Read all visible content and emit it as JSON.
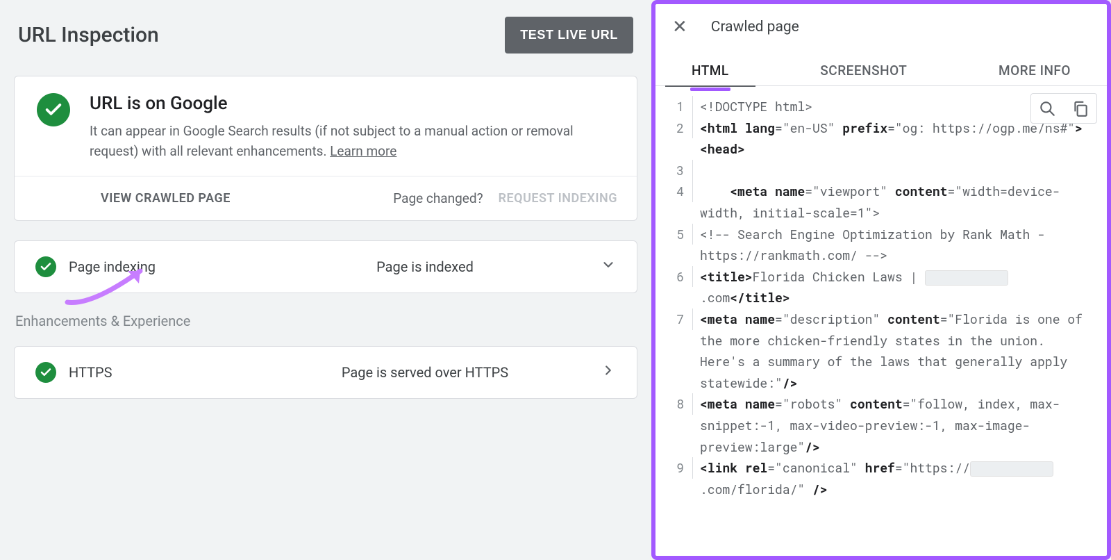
{
  "header": {
    "title": "URL Inspection",
    "test_live_label": "TEST LIVE URL"
  },
  "status": {
    "heading": "URL is on Google",
    "description_a": "It can appear in Google Search results (if not subject to a manual action or removal request) with all relevant enhancements. ",
    "learn_more": "Learn more"
  },
  "actions": {
    "view_crawled": "VIEW CRAWLED PAGE",
    "page_changed": "Page changed?",
    "request_indexing": "REQUEST INDEXING"
  },
  "rows": {
    "page_indexing_label": "Page indexing",
    "page_indexing_value": "Page is indexed",
    "https_label": "HTTPS",
    "https_value": "Page is served over HTTPS"
  },
  "section_heading": "Enhancements & Experience",
  "right": {
    "title": "Crawled page",
    "tabs": {
      "html": "HTML",
      "screenshot": "SCREENSHOT",
      "more": "MORE INFO"
    }
  },
  "code": {
    "l1": "<!DOCTYPE html>",
    "l2a": "<html lang",
    "l2b": "=\"en-US\" ",
    "l2c": "prefix",
    "l2d": "=\"og: https://ogp.me/ns#\"",
    "l2e": "><head>",
    "l4": "    <meta name",
    "l4b": "=\"viewport\" ",
    "l4c": "content",
    "l4d": "=\"width=device-width, initial-scale=1\">",
    "l5": "<!-- Search Engine Optimization by Rank Math - https://rankmath.com/ -->",
    "l6a": "<title>",
    "l6b": "Florida Chicken Laws | ",
    "l6c": ".com",
    "l6d": "</title>",
    "l7a": "<meta name",
    "l7b": "=\"description\" ",
    "l7c": "content",
    "l7d": "=\"Florida is one of the more chicken-friendly states in the union. Here's a summary of the laws that generally apply statewide:\"",
    "l7e": "/>",
    "l8a": "<meta name",
    "l8b": "=\"robots\" ",
    "l8c": "content",
    "l8d": "=\"follow, index, max-snippet:-1, max-video-preview:-1, max-image-preview:large\"",
    "l8e": "/>",
    "l9a": "<link rel",
    "l9b": "=\"canonical\" ",
    "l9c": "href",
    "l9d": "=\"https://",
    "l9e": ".com/florida/\" ",
    "l9f": "/>"
  }
}
